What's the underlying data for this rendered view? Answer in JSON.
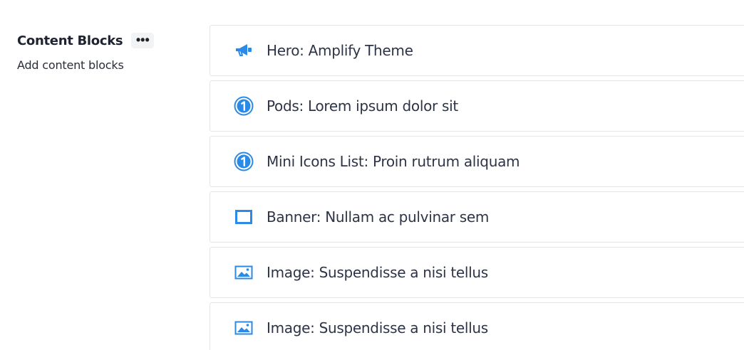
{
  "section": {
    "title": "Content Blocks",
    "more_label": "•••",
    "subtitle": "Add content blocks"
  },
  "colors": {
    "accent": "#2b8ae6",
    "border": "#e3e5e8",
    "text": "#2e3447"
  },
  "blocks": [
    {
      "icon": "megaphone-icon",
      "label": "Hero: Amplify Theme"
    },
    {
      "icon": "number-one-circle-icon",
      "label": "Pods: Lorem ipsum dolor sit"
    },
    {
      "icon": "number-one-circle-icon",
      "label": "Mini Icons List: Proin rutrum aliquam"
    },
    {
      "icon": "banner-frame-icon",
      "label": "Banner: Nullam ac pulvinar sem"
    },
    {
      "icon": "image-icon",
      "label": "Image: Suspendisse a nisi tellus"
    },
    {
      "icon": "image-icon",
      "label": "Image: Suspendisse a nisi tellus"
    }
  ]
}
